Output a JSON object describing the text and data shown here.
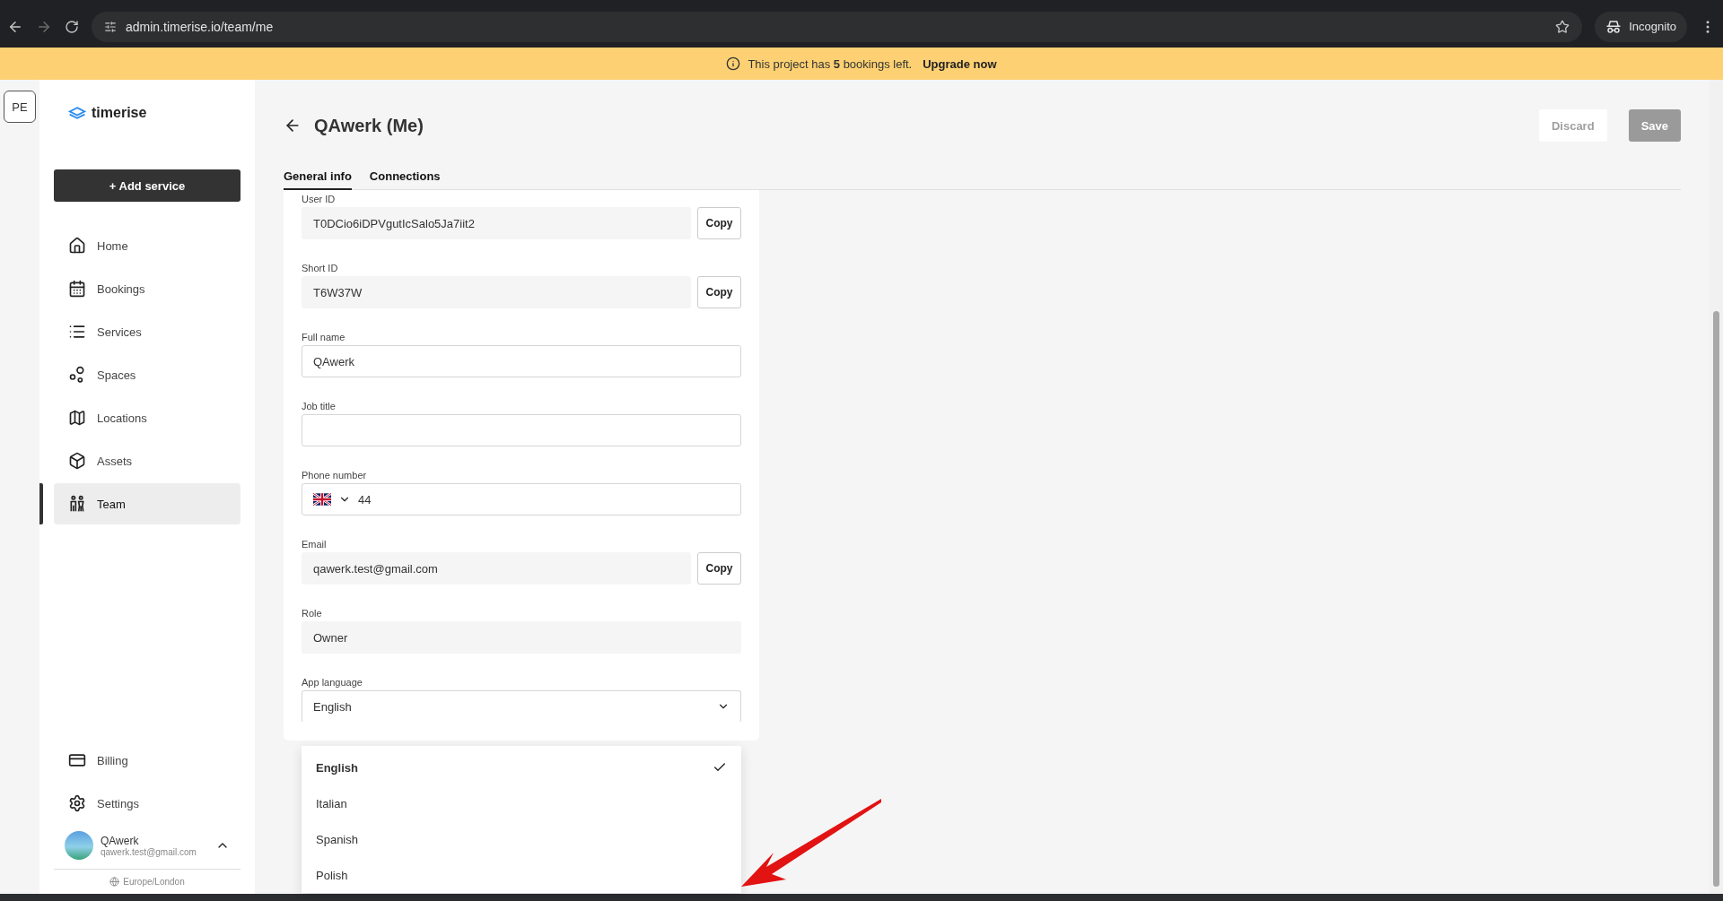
{
  "browser": {
    "url": "admin.timerise.io/team/me",
    "profile": "Incognito"
  },
  "banner": {
    "text": "This project has **5** bookings left.",
    "link": "Upgrade now"
  },
  "workspace_badge": "PE",
  "sidebar": {
    "logo": "timerise",
    "add_button": "+ Add service",
    "nav_items": [
      {
        "label": "Home",
        "selected": false
      },
      {
        "label": "Bookings",
        "selected": false
      },
      {
        "label": "Services",
        "selected": false
      },
      {
        "label": "Spaces",
        "selected": false
      },
      {
        "label": "Locations",
        "selected": false
      },
      {
        "label": "Assets",
        "selected": false
      },
      {
        "label": "Team",
        "selected": true
      }
    ],
    "bottom_items": [
      {
        "label": "Billing",
        "selected": false
      },
      {
        "label": "Settings",
        "selected": false
      }
    ],
    "user": {
      "name": "QAwerk",
      "email": "qawerk.test@gmail.com"
    },
    "timezone": "Europe/London"
  },
  "page": {
    "title": "QAwerk (Me)",
    "actions": [
      {
        "label": "Discard",
        "kind": "secondary",
        "disabled": true
      },
      {
        "label": "Save",
        "kind": "primary",
        "disabled": true
      }
    ],
    "tabs": [
      {
        "label": "General info",
        "selected": true
      },
      {
        "label": "Connections",
        "selected": false
      }
    ],
    "fields": [
      {
        "label": "User ID",
        "kind": "readonly",
        "value": "T0DCio6iDPVgutIcSalo5Ja7iit2",
        "copy": "Copy"
      },
      {
        "label": "Short ID",
        "kind": "readonly",
        "value": "T6W37W",
        "copy": "Copy"
      },
      {
        "label": "Full name",
        "kind": "text",
        "value": "QAwerk"
      },
      {
        "label": "Job title",
        "kind": "text"
      },
      {
        "label": "Phone number",
        "kind": "phone",
        "value": "44"
      },
      {
        "label": "Email",
        "kind": "readonly",
        "value": "qawerk.test@gmail.com",
        "copy": "Copy"
      },
      {
        "label": "Role",
        "kind": "readonly",
        "value": "Owner"
      },
      {
        "label": "App language",
        "kind": "select",
        "value": "English",
        "expanded": true
      }
    ],
    "language_options": [
      {
        "label": "English",
        "selected": true
      },
      {
        "label": "Italian",
        "selected": false
      },
      {
        "label": "Spanish",
        "selected": false
      },
      {
        "label": "Polish",
        "selected": false
      }
    ]
  }
}
